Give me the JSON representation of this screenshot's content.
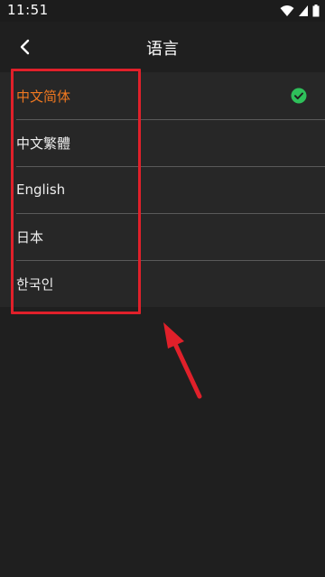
{
  "status_bar": {
    "time": "11:51"
  },
  "header": {
    "title": "语言",
    "back_icon": "chevron-left-icon"
  },
  "languages": {
    "items": [
      {
        "label": "中文简体",
        "selected": true
      },
      {
        "label": "中文繁體",
        "selected": false
      },
      {
        "label": "English",
        "selected": false
      },
      {
        "label": "日本",
        "selected": false
      },
      {
        "label": "한국인",
        "selected": false
      }
    ],
    "selected_icon": "check-circle-icon"
  },
  "colors": {
    "background": "#1f1f1f",
    "list_background": "#272727",
    "selected_text": "#f07820",
    "check_green": "#2ec05a",
    "annotation_red": "#e0202a"
  }
}
